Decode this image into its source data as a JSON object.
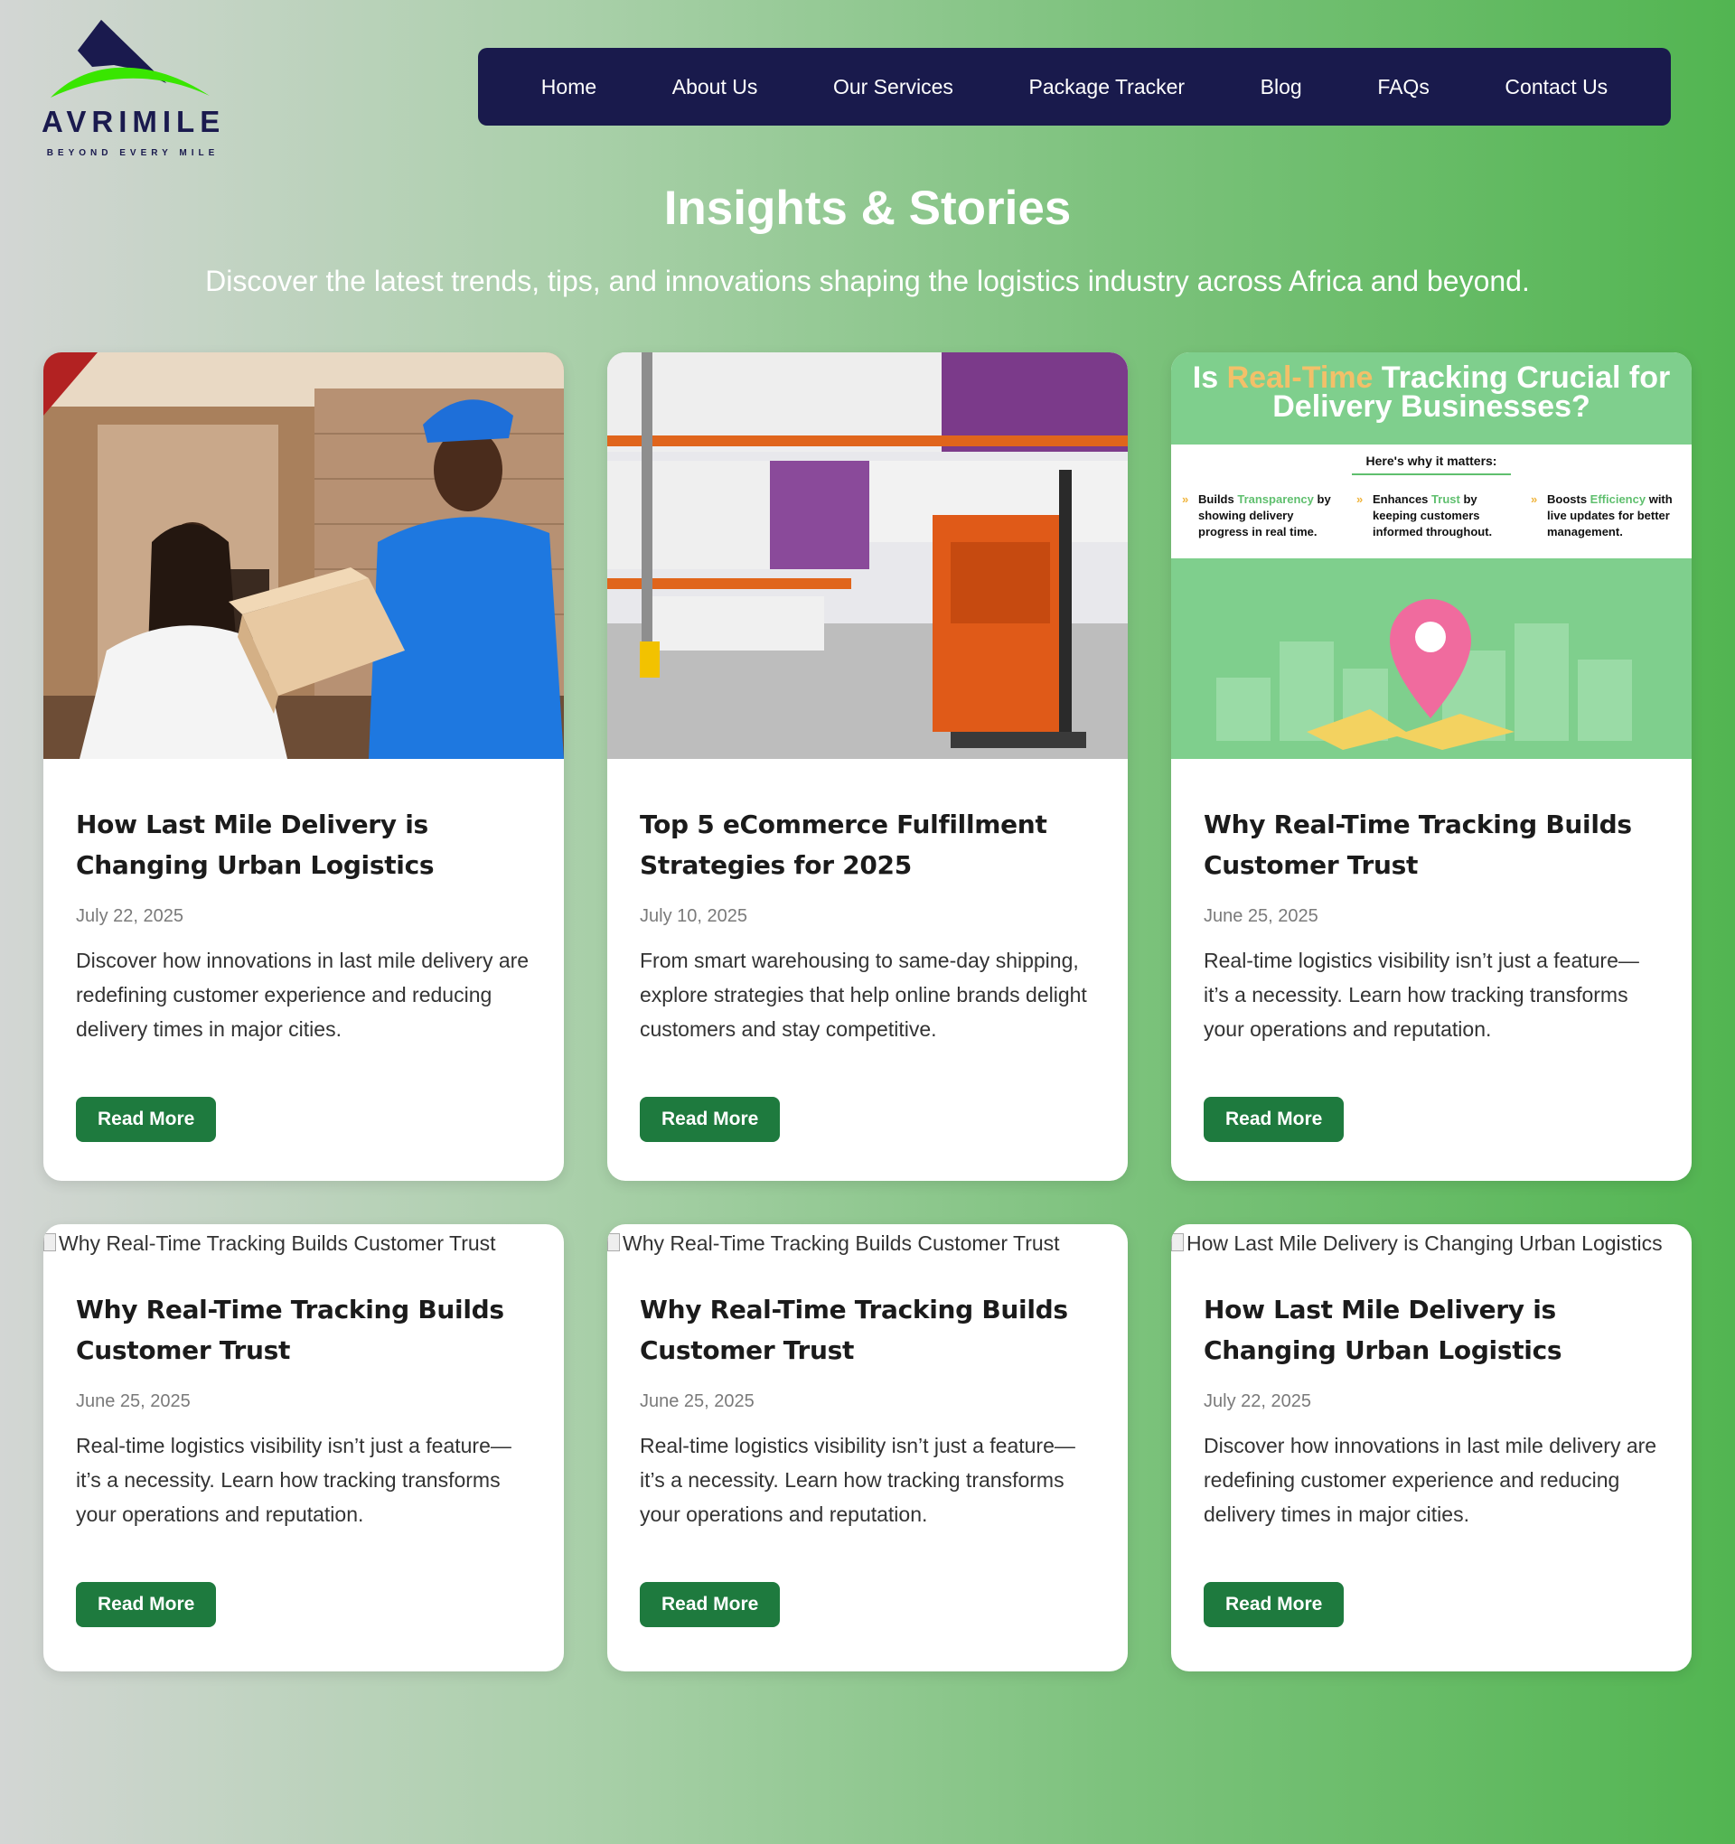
{
  "brand": {
    "name": "AVRIMILE",
    "tagline": "BEYOND EVERY MILE"
  },
  "nav": {
    "items": [
      "Home",
      "About Us",
      "Our Services",
      "Package Tracker",
      "Blog",
      "FAQs",
      "Contact Us"
    ]
  },
  "hero": {
    "title": "Insights & Stories",
    "subtitle": "Discover the latest trends, tips, and innovations shaping the logistics industry across Africa and beyond."
  },
  "infographic": {
    "title_pre": "Is ",
    "title_highlight": "Real-Time",
    "title_post": " Tracking Crucial for",
    "title_line2": "Delivery Businesses?",
    "why": "Here's why it matters:",
    "points": [
      {
        "pre": "Builds ",
        "hl": "Transparency",
        "post": " by showing delivery progress in real time."
      },
      {
        "pre": "Enhances ",
        "hl": "Trust",
        "post": " by keeping customers informed throughout."
      },
      {
        "pre": "Boosts ",
        "hl": "Efficiency",
        "post": " with live updates for better management."
      }
    ]
  },
  "posts": [
    {
      "title": "How Last Mile Delivery is Changing Urban Logistics",
      "date": "July 22, 2025",
      "excerpt": "Discover how innovations in last mile delivery are redefining customer experience and reducing delivery times in major cities.",
      "cta": "Read More"
    },
    {
      "title": "Top 5 eCommerce Fulfillment Strategies for 2025",
      "date": "July 10, 2025",
      "excerpt": "From smart warehousing to same-day shipping, explore strategies that help online brands delight customers and stay competitive.",
      "cta": "Read More"
    },
    {
      "title": "Why Real-Time Tracking Builds Customer Trust",
      "date": "June 25, 2025",
      "excerpt": "Real-time logistics visibility isn’t just a feature—it’s a necessity. Learn how tracking transforms your operations and reputation.",
      "cta": "Read More"
    },
    {
      "img_alt": "Why Real-Time Tracking Builds Customer Trust",
      "title": "Why Real-Time Tracking Builds Customer Trust",
      "date": "June 25, 2025",
      "excerpt": "Real-time logistics visibility isn’t just a feature—it’s a necessity. Learn how tracking transforms your operations and reputation.",
      "cta": "Read More"
    },
    {
      "img_alt": "Why Real-Time Tracking Builds Customer Trust",
      "title": "Why Real-Time Tracking Builds Customer Trust",
      "date": "June 25, 2025",
      "excerpt": "Real-time logistics visibility isn’t just a feature—it’s a necessity. Learn how tracking transforms your operations and reputation.",
      "cta": "Read More"
    },
    {
      "img_alt": "How Last Mile Delivery is Changing Urban Logistics",
      "title": "How Last Mile Delivery is Changing Urban Logistics",
      "date": "July 22, 2025",
      "excerpt": "Discover how innovations in last mile delivery are redefining customer experience and reducing delivery times in major cities.",
      "cta": "Read More"
    }
  ],
  "colors": {
    "nav_bg": "#191a4c",
    "button": "#1e7a3e",
    "brand_navy": "#1a1a4e",
    "brand_green": "#39e600"
  }
}
